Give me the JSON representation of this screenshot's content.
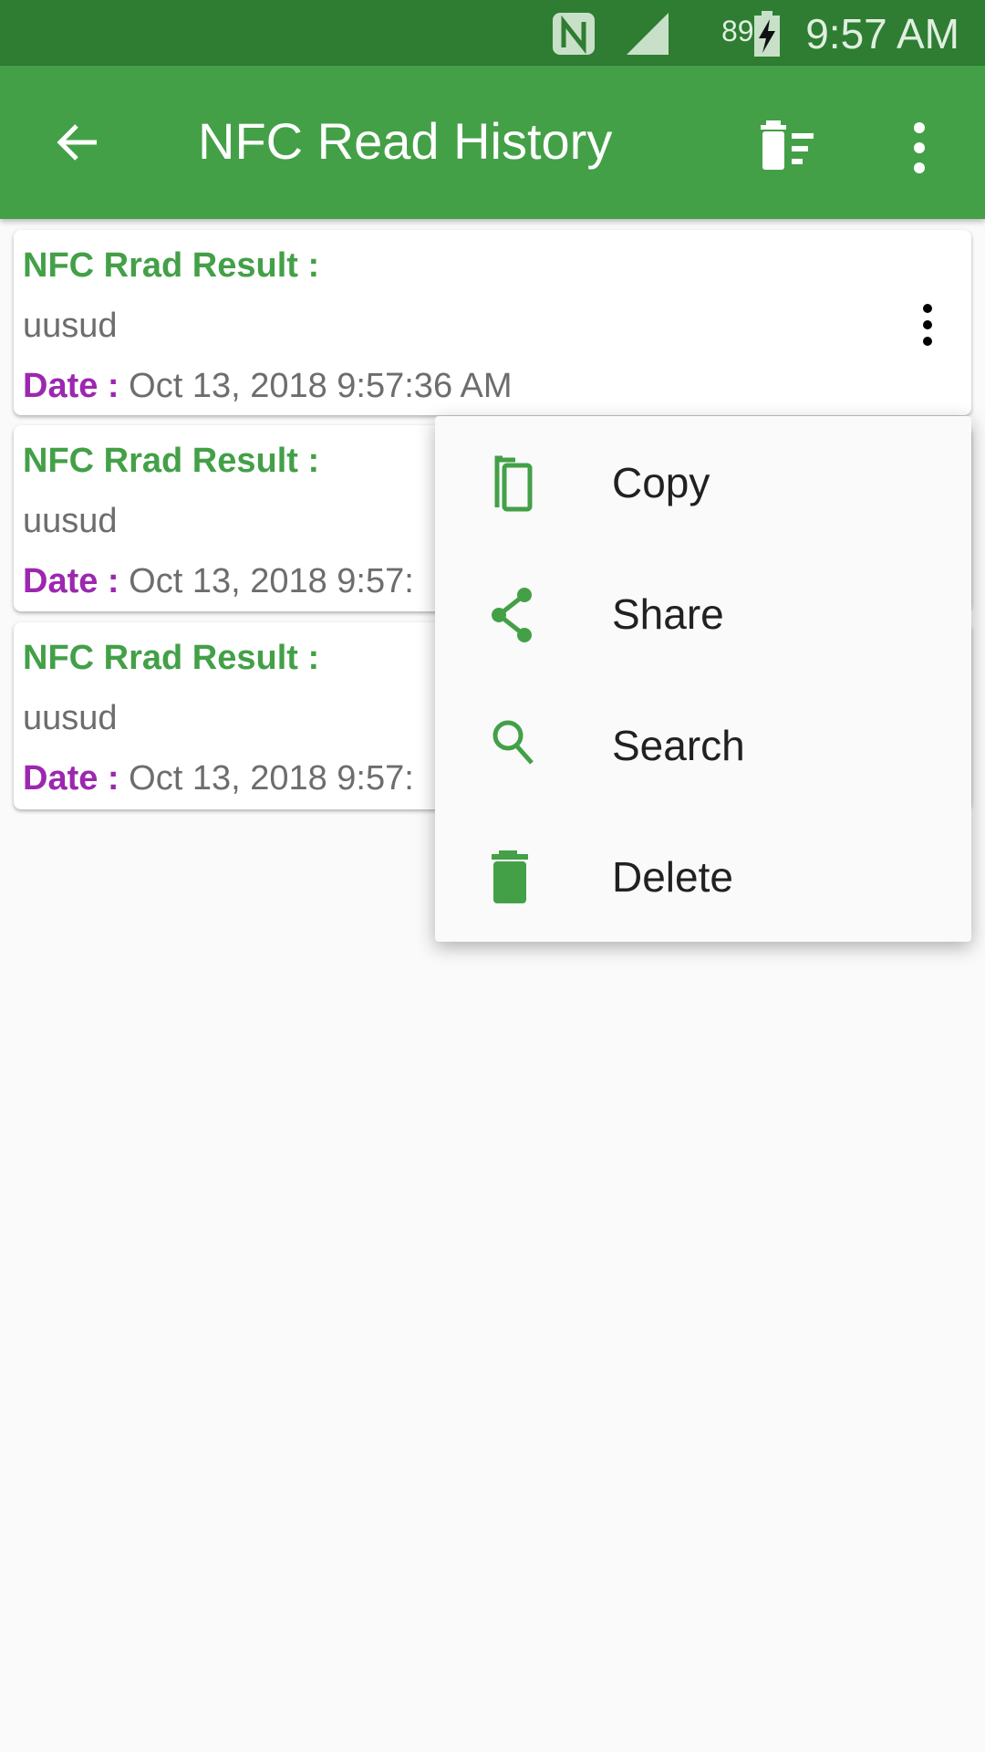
{
  "status_bar": {
    "battery": "89%",
    "time": "9:57 AM",
    "icons": [
      "nfc-icon",
      "signal-icon",
      "battery-charging-icon"
    ]
  },
  "toolbar": {
    "title": "NFC Read History",
    "icons": [
      "back-arrow-icon",
      "delete-all-icon",
      "more-vert-icon"
    ]
  },
  "records": [
    {
      "label": "NFC Rrad Result :",
      "value": "uusud",
      "date_label": "Date :",
      "date": "Oct 13, 2018 9:57:36 AM"
    },
    {
      "label": "NFC Rrad Result :",
      "value": "uusud",
      "date_label": "Date :",
      "date": "Oct 13, 2018 9:57:"
    },
    {
      "label": "NFC Rrad Result :",
      "value": "uusud",
      "date_label": "Date :",
      "date": "Oct 13, 2018 9:57:"
    }
  ],
  "menu": {
    "items": [
      {
        "label": "Copy",
        "icon": "copy-icon"
      },
      {
        "label": "Share",
        "icon": "share-icon"
      },
      {
        "label": "Search",
        "icon": "search-icon"
      },
      {
        "label": "Delete",
        "icon": "delete-icon"
      }
    ]
  },
  "colors": {
    "primary": "#43a047",
    "primary_dark": "#2e7d32",
    "date_label": "#9c27b0"
  }
}
